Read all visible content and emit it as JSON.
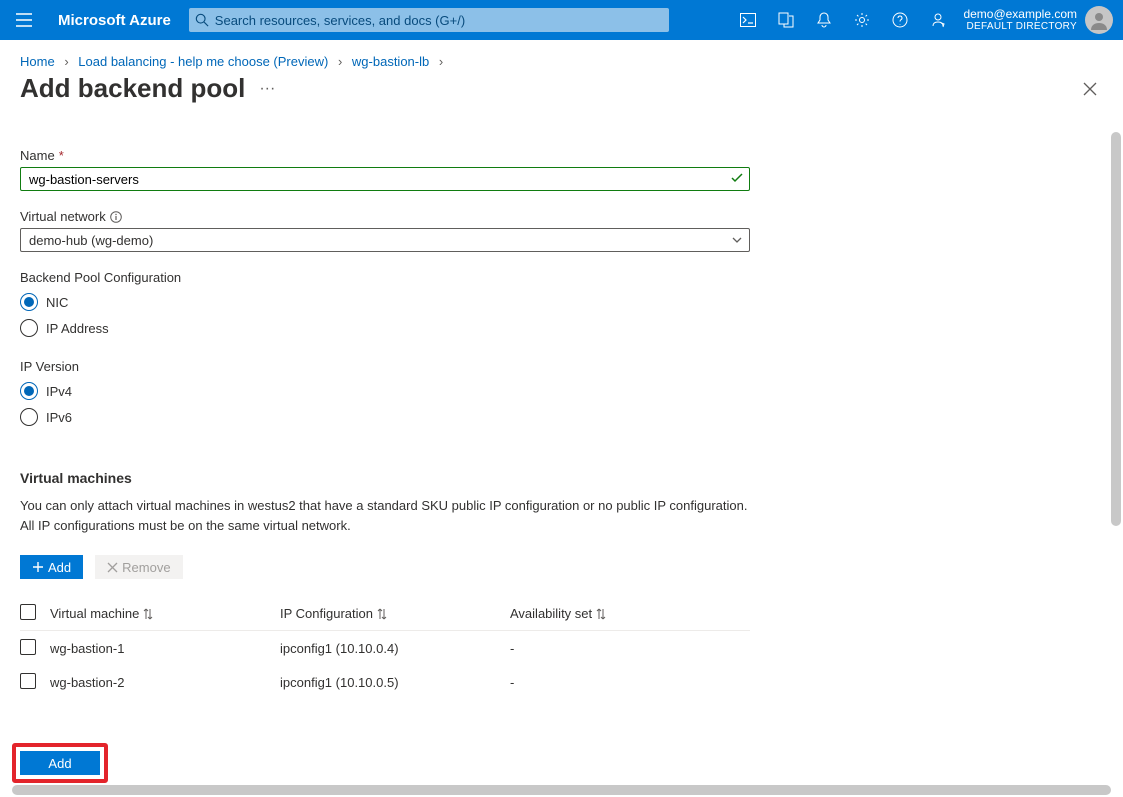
{
  "topbar": {
    "brand": "Microsoft Azure",
    "search_placeholder": "Search resources, services, and docs (G+/)",
    "account_email": "demo@example.com",
    "account_directory": "DEFAULT DIRECTORY"
  },
  "breadcrumb": {
    "items": [
      "Home",
      "Load balancing - help me choose (Preview)",
      "wg-bastion-lb"
    ]
  },
  "page": {
    "title": "Add backend pool"
  },
  "form": {
    "name_label": "Name",
    "name_value": "wg-bastion-servers",
    "vnet_label": "Virtual network",
    "vnet_value": "demo-hub (wg-demo)",
    "backend_config_label": "Backend Pool Configuration",
    "backend_config_options": [
      "NIC",
      "IP Address"
    ],
    "backend_config_selected": "NIC",
    "ip_version_label": "IP Version",
    "ip_version_options": [
      "IPv4",
      "IPv6"
    ],
    "ip_version_selected": "IPv4"
  },
  "vm_section": {
    "heading": "Virtual machines",
    "note_line1": "You can only attach virtual machines in westus2 that have a standard SKU public IP configuration or no public IP configuration.",
    "note_line2": "All IP configurations must be on the same virtual network.",
    "add_label": "Add",
    "remove_label": "Remove",
    "columns": [
      "Virtual machine",
      "IP Configuration",
      "Availability set"
    ],
    "rows": [
      {
        "vm": "wg-bastion-1",
        "ipconfig": "ipconfig1 (10.10.0.4)",
        "avset": "-"
      },
      {
        "vm": "wg-bastion-2",
        "ipconfig": "ipconfig1 (10.10.0.5)",
        "avset": "-"
      }
    ]
  },
  "footer": {
    "add_label": "Add"
  }
}
